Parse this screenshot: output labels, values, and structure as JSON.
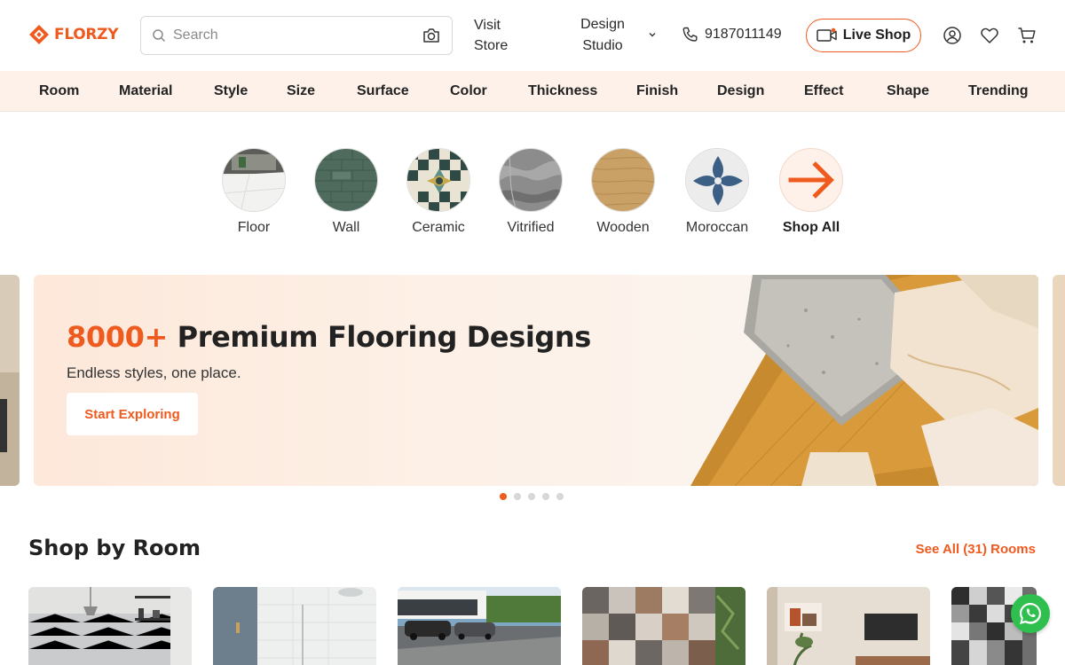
{
  "brand": {
    "name": "FLORZY",
    "color": "#ef5a1f"
  },
  "header": {
    "search_placeholder": "Search",
    "visit_store": "Visit Store",
    "design_studio": "Design Studio",
    "phone": "9187011149",
    "live_shop": "Live Shop",
    "icons": [
      "search-icon",
      "camera-icon",
      "chevron-down-icon",
      "phone-icon",
      "video-icon",
      "account-icon",
      "heart-icon",
      "cart-icon"
    ]
  },
  "categories": [
    "Room",
    "Material",
    "Style",
    "Size",
    "Surface",
    "Color",
    "Thickness",
    "Finish",
    "Design",
    "Effect",
    "Shape",
    "Trending"
  ],
  "tile_types": [
    {
      "label": "Floor"
    },
    {
      "label": "Wall"
    },
    {
      "label": "Ceramic"
    },
    {
      "label": "Vitrified"
    },
    {
      "label": "Wooden"
    },
    {
      "label": "Moroccan"
    },
    {
      "label": "Shop All"
    }
  ],
  "banner": {
    "highlight": "8000+",
    "title": "Premium Flooring Designs",
    "subtitle": "Endless styles, one place.",
    "cta": "Start Exploring",
    "slide_count": 5,
    "active_slide": 1
  },
  "shop_by_room": {
    "title": "Shop by Room",
    "see_all": "See All (31) Rooms"
  },
  "colors": {
    "accent": "#ef5a1f",
    "catbar_bg": "#fdf1ea",
    "whatsapp": "#2fbf4f"
  }
}
